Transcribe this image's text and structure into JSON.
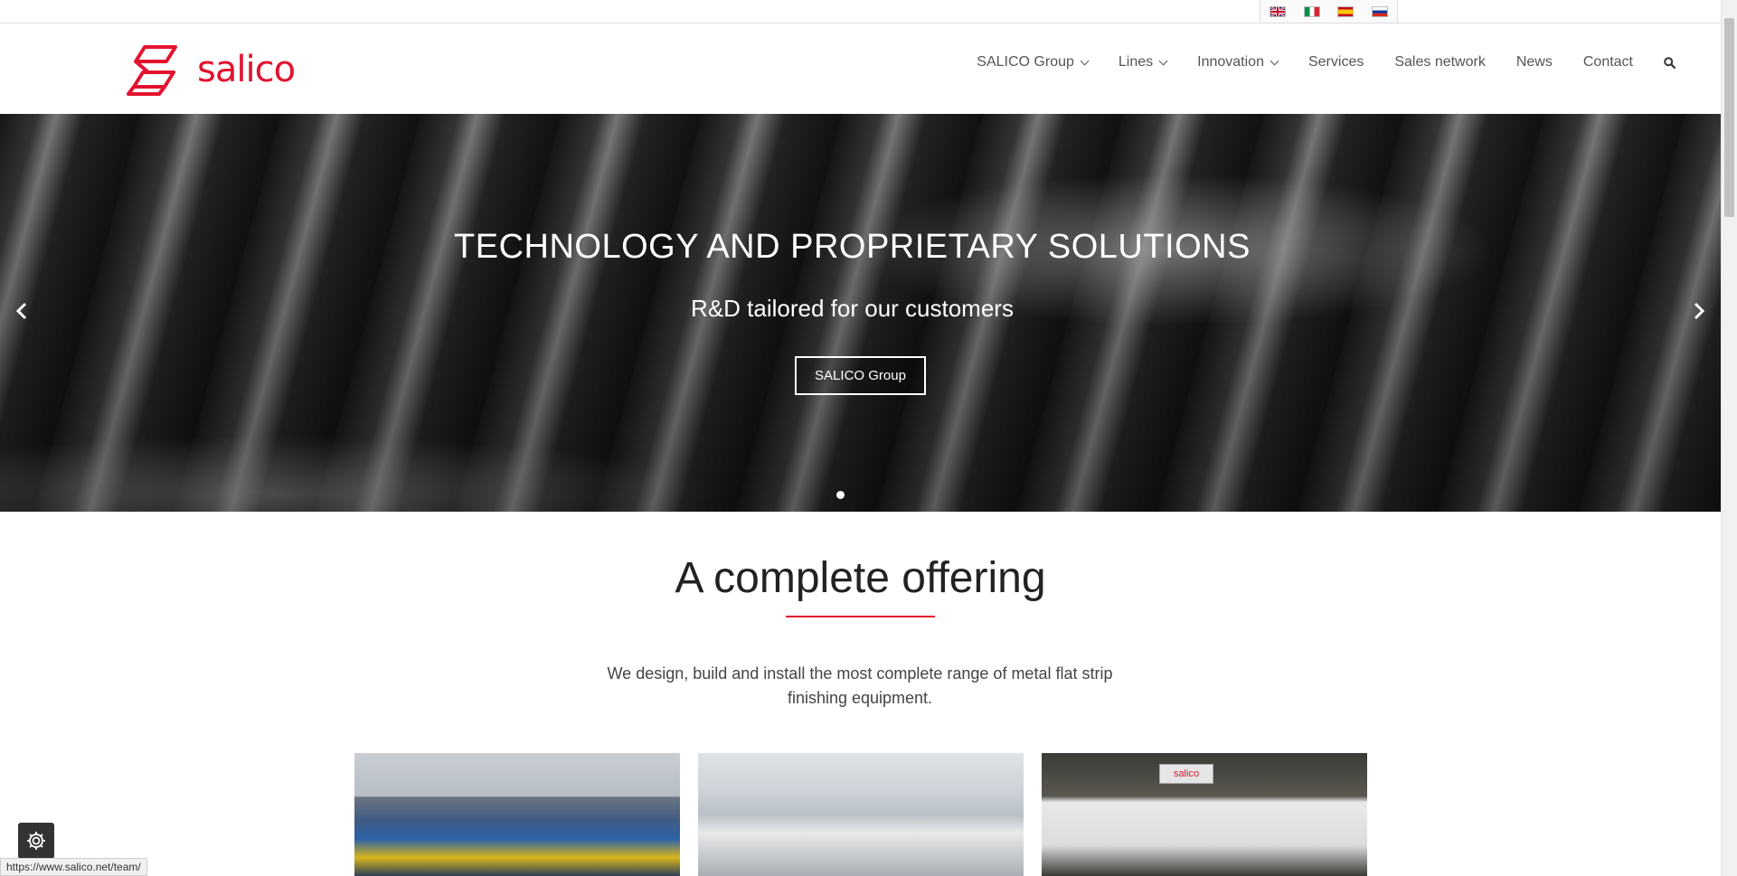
{
  "languages": [
    {
      "name": "flag-en-icon",
      "code": "EN"
    },
    {
      "name": "flag-it-icon",
      "code": "IT"
    },
    {
      "name": "flag-es-icon",
      "code": "ES"
    },
    {
      "name": "flag-ru-icon",
      "code": "RU"
    }
  ],
  "brand": {
    "name": "salico",
    "color": "#e2132f"
  },
  "nav": {
    "items": [
      {
        "label": "SALICO Group",
        "dropdown": true
      },
      {
        "label": "Lines",
        "dropdown": true
      },
      {
        "label": "Innovation",
        "dropdown": true
      },
      {
        "label": "Services",
        "dropdown": false
      },
      {
        "label": "Sales network",
        "dropdown": false
      },
      {
        "label": "News",
        "dropdown": false
      },
      {
        "label": "Contact",
        "dropdown": false
      }
    ],
    "search_icon": "search-icon"
  },
  "hero": {
    "title": "TECHNOLOGY AND PROPRIETARY SOLUTIONS",
    "subtitle": "R&D tailored for our customers",
    "button_label": "SALICO Group",
    "prev_icon": "chevron-left-icon",
    "next_icon": "chevron-right-icon",
    "slides_count": 1,
    "active_slide": 1
  },
  "offering": {
    "title": "A complete offering",
    "text": "We design, build and install the most complete range of metal flat strip finishing equipment.",
    "tiles": [
      {
        "name": "tile-1"
      },
      {
        "name": "tile-2"
      },
      {
        "name": "tile-3",
        "badge": "salico"
      }
    ]
  },
  "status_bar": {
    "url": "https://www.salico.net/team/"
  },
  "settings_icon": "gear-icon"
}
